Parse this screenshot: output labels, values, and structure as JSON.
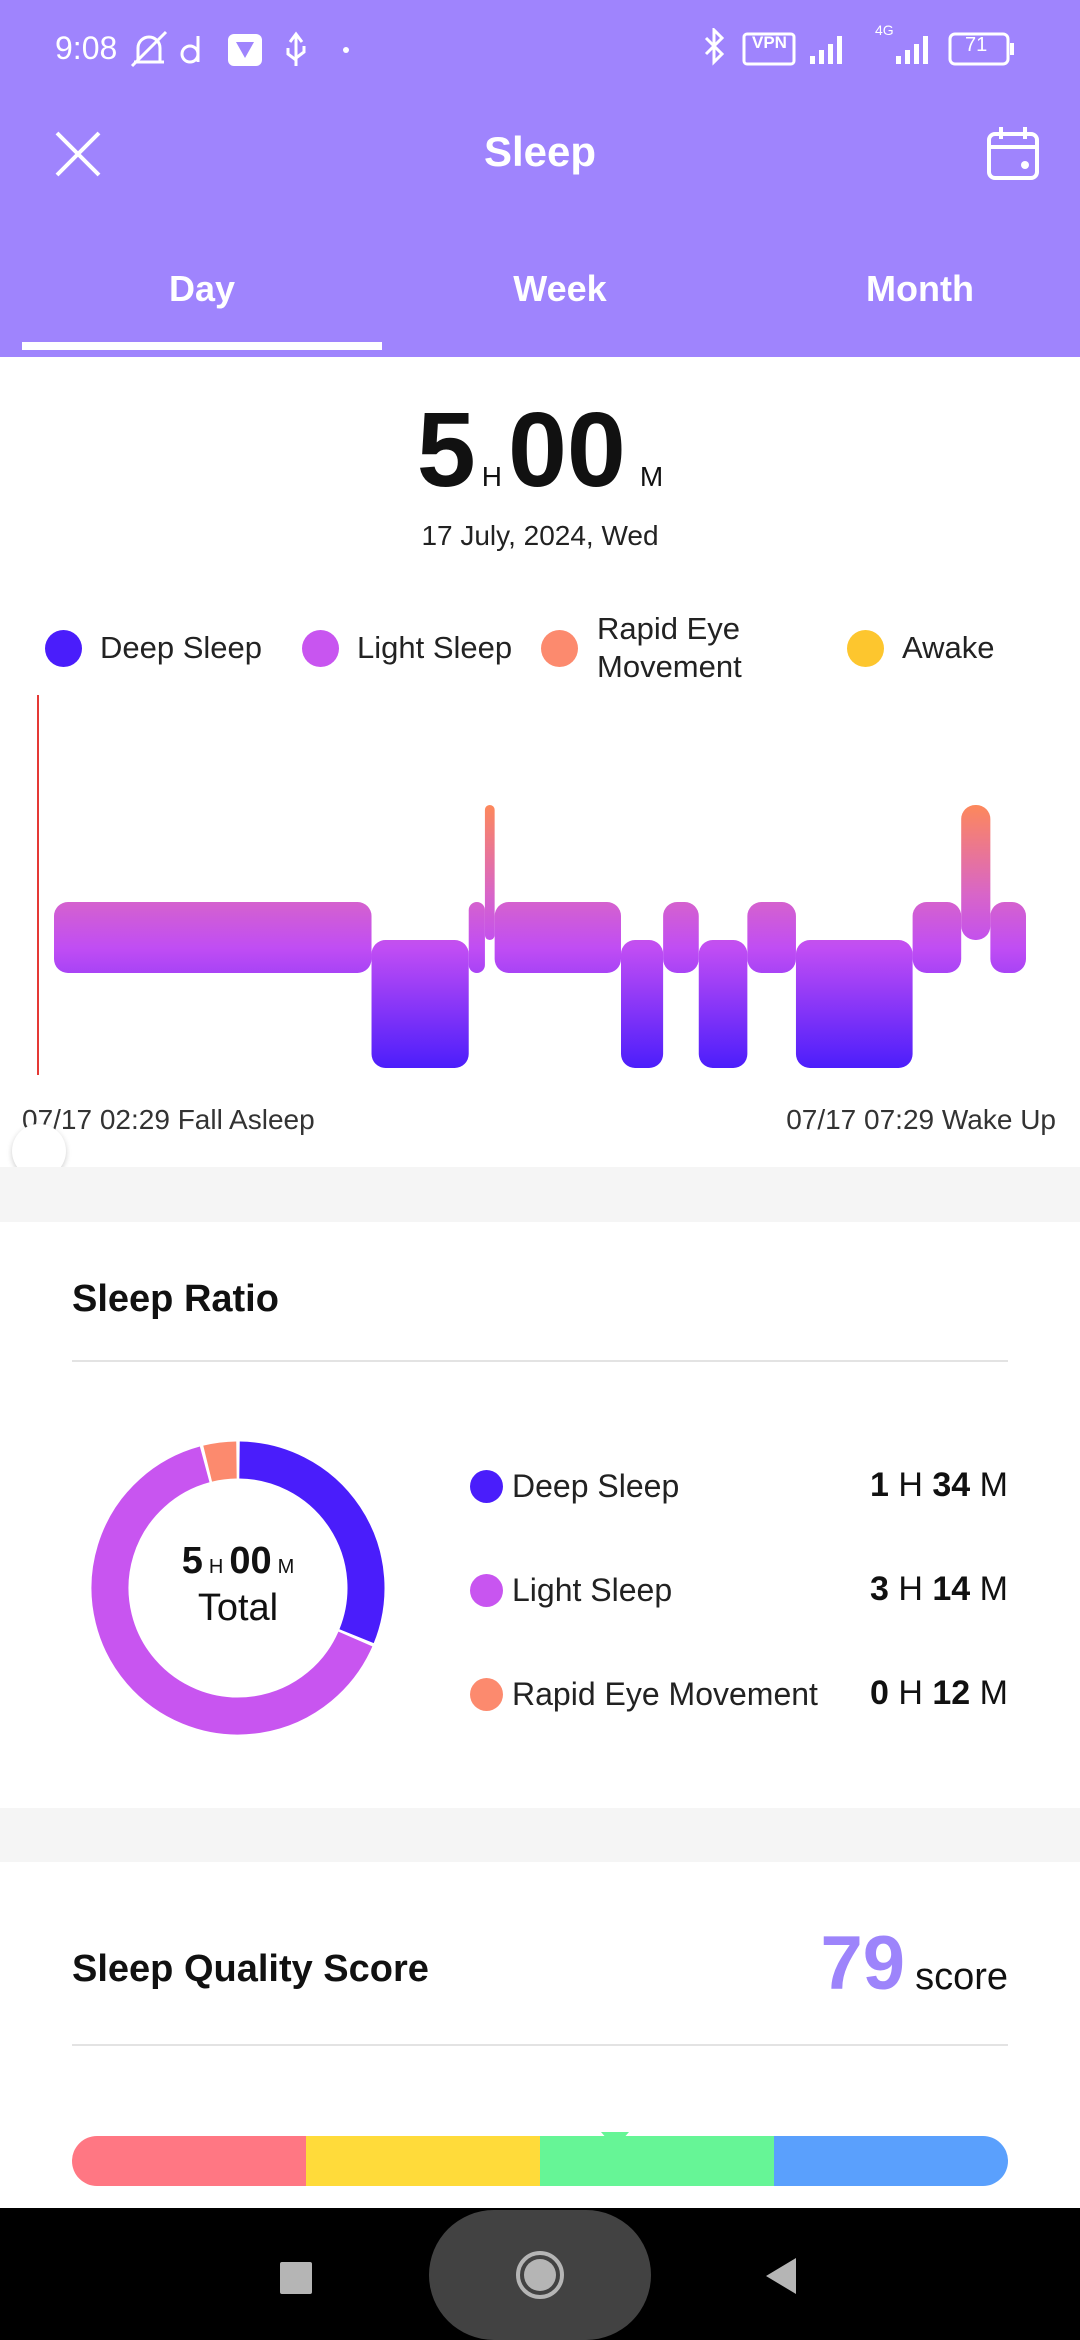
{
  "status_bar": {
    "time": "9:08",
    "vpn": "VPN",
    "network": "4G",
    "battery": "71"
  },
  "header": {
    "title": "Sleep",
    "close_icon": "close-icon",
    "calendar_icon": "calendar-icon"
  },
  "tabs": [
    {
      "label": "Day",
      "active": true
    },
    {
      "label": "Week"
    },
    {
      "label": "Month"
    }
  ],
  "summary": {
    "hours": "5",
    "h_unit": "H",
    "minutes": "00",
    "m_unit": "M",
    "date": "17 July, 2024, Wed"
  },
  "legend": [
    {
      "label": "Deep Sleep",
      "color": "#4a1dfb"
    },
    {
      "label": "Light Sleep",
      "color": "#c855f0"
    },
    {
      "label": "Rapid Eye Movement",
      "color": "#fc8a6e"
    },
    {
      "label": "Awake",
      "color": "#fdc62e"
    }
  ],
  "chart_data": {
    "type": "hypnogram",
    "x_start": "07/17 02:29",
    "x_end": "07/17 07:29",
    "start_label": "07/17 02:29 Fall Asleep",
    "end_label": "07/17 07:29 Wake Up",
    "segments": [
      {
        "stage": "light",
        "minutes": 98
      },
      {
        "stage": "deep",
        "minutes": 30
      },
      {
        "stage": "light",
        "minutes": 5
      },
      {
        "stage": "rem",
        "minutes": 3
      },
      {
        "stage": "light",
        "minutes": 39
      },
      {
        "stage": "deep",
        "minutes": 13
      },
      {
        "stage": "light",
        "minutes": 11
      },
      {
        "stage": "deep",
        "minutes": 15
      },
      {
        "stage": "light",
        "minutes": 15
      },
      {
        "stage": "deep",
        "minutes": 36
      },
      {
        "stage": "light",
        "minutes": 15
      },
      {
        "stage": "rem",
        "minutes": 9
      },
      {
        "stage": "light",
        "minutes": 11
      }
    ]
  },
  "ratio": {
    "title": "Sleep Ratio",
    "total_h": "5",
    "total_m": "00",
    "h_unit": "H",
    "m_unit": "M",
    "total_label": "Total",
    "items": [
      {
        "label": "Deep Sleep",
        "h": "1",
        "m": "34",
        "minutes": 94,
        "color": "#4a1dfb"
      },
      {
        "label": "Light Sleep",
        "h": "3",
        "m": "14",
        "minutes": 194,
        "color": "#c855f0"
      },
      {
        "label": "Rapid Eye Movement",
        "h": "0",
        "m": "12",
        "minutes": 12,
        "color": "#fc8a6e"
      }
    ]
  },
  "score": {
    "title": "Sleep Quality Score",
    "value": "79",
    "unit": "score",
    "accent": "#9d84fb",
    "band_colors": [
      "#ff7783",
      "#ffdb3a",
      "#66f596",
      "#5aa0fd"
    ],
    "marker_position_percent": 58
  }
}
